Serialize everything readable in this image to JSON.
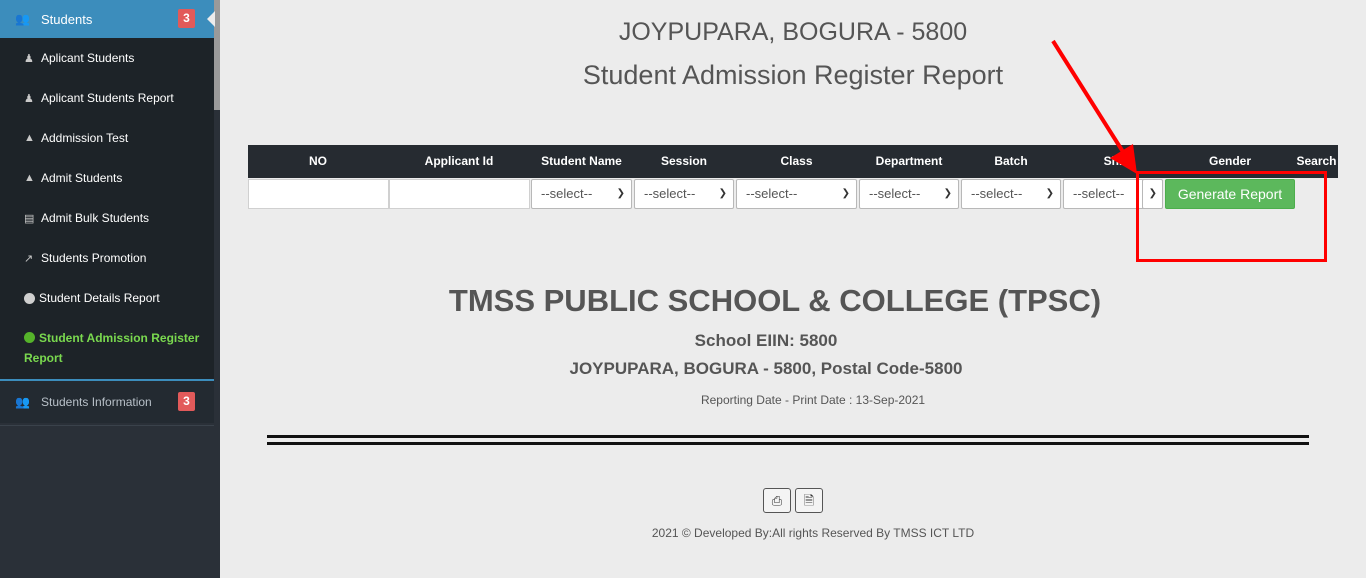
{
  "sidebar": {
    "header": {
      "label": "Students",
      "badge": "3",
      "icon": "users-icon"
    },
    "items": [
      {
        "label": "Aplicant Students",
        "icon": "user-plus-icon"
      },
      {
        "label": "Aplicant Students Report",
        "icon": "user-plus-icon"
      },
      {
        "label": "Addmission Test",
        "icon": "graduation-cap-icon"
      },
      {
        "label": "Admit Students",
        "icon": "graduation-cap-icon"
      },
      {
        "label": "Admit Bulk Students",
        "icon": "id-card-icon"
      },
      {
        "label": "Students Promotion",
        "icon": "line-chart-icon"
      },
      {
        "label": "Student Details Report",
        "icon": "circle-icon"
      },
      {
        "label": "Student Admission Register Report",
        "icon": "circle-icon",
        "active": true
      }
    ],
    "info": {
      "label": "Students Information",
      "badge": "3",
      "icon": "users-icon"
    }
  },
  "header": {
    "address": "JOYPUPARA, BOGURA - 5800",
    "title": "Student Admission Register Report"
  },
  "filter_table": {
    "columns": [
      "NO",
      "Applicant Id",
      "Student Name",
      "Session",
      "Class",
      "Department",
      "Batch",
      "Shi",
      "Gender",
      "Search"
    ],
    "select_placeholder": "--select--",
    "generate_label": "Generate Report"
  },
  "report": {
    "school_name": "TMSS PUBLIC SCHOOL & COLLEGE (TPSC)",
    "eiin": "School EIIN: 5800",
    "address": "JOYPUPARA, BOGURA - 5800, Postal Code-5800",
    "reporting_date": "Reporting Date - Print Date : 13-Sep-2021"
  },
  "footer": {
    "text": "2021 © Developed By:All rights Reserved By TMSS ICT LTD"
  },
  "colors": {
    "sidebar_bg": "#2a3038",
    "sidebar_active": "#3c8dbc",
    "active_item": "#7ad94f",
    "badge": "#e25a5a",
    "generate_button": "#5cb85c",
    "annotation": "#ff0000"
  }
}
